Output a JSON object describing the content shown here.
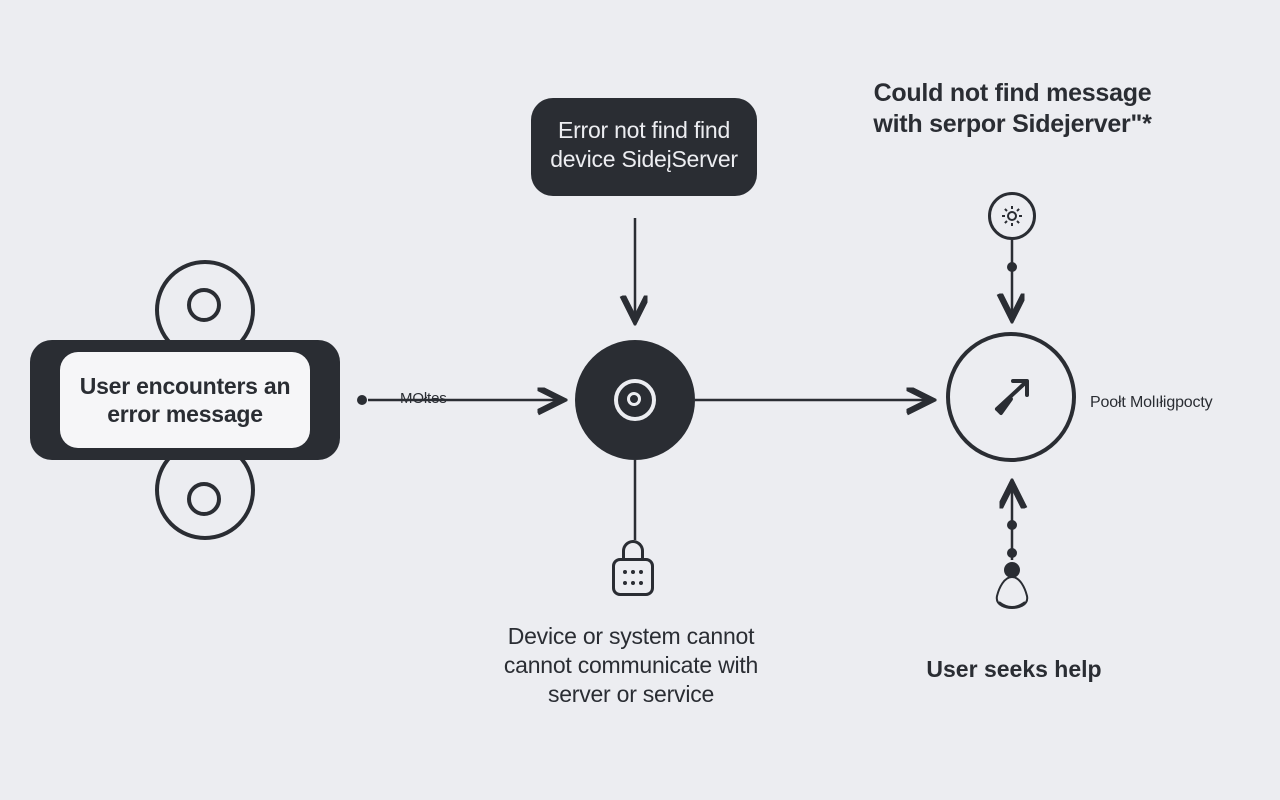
{
  "left_node": {
    "text": "User encounters an error message"
  },
  "edge1": {
    "label": "MOłtes"
  },
  "top_callout": {
    "text": "Error not find find device SideįServer"
  },
  "center_caption": "Device or system cannot cannot communicate with server or service",
  "right_heading": "Could not find message with serpor Sidejerver\"*",
  "right_side_label": "Poołt Molıłigpocty",
  "right_caption": "User seeks help",
  "icons": {
    "left_device": "device-icon",
    "center": "target-icon",
    "lock": "lock-icon",
    "gear": "gear-icon",
    "compass": "compass-arrow-icon",
    "person": "meditating-person-icon"
  },
  "colors": {
    "bg": "#ecedf1",
    "ink": "#2a2d33"
  }
}
